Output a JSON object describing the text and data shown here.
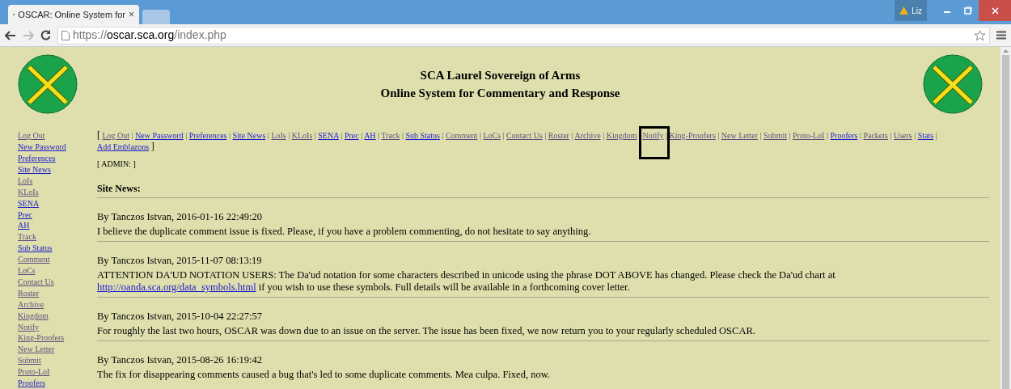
{
  "browser": {
    "tab_title": "OSCAR: Online System for",
    "tab_close": "×",
    "profile_name": "Liz",
    "url_scheme": "https://",
    "url_host": "oscar.sca.org",
    "url_path": "/index.php",
    "back_enabled": true,
    "forward_enabled": false
  },
  "header": {
    "title_line_1": "SCA Laurel Sovereign of Arms",
    "title_line_2": "Online System for Commentary and Response"
  },
  "sidebar": {
    "items": [
      {
        "label": "Log Out",
        "visited": true
      },
      {
        "label": "New Password",
        "visited": false
      },
      {
        "label": "Preferences",
        "visited": false
      },
      {
        "label": "Site News",
        "visited": false
      },
      {
        "label": "LoIs",
        "visited": true
      },
      {
        "label": "KLoIs",
        "visited": true
      },
      {
        "label": "SENA",
        "visited": false
      },
      {
        "label": "Prec",
        "visited": false
      },
      {
        "label": "AH",
        "visited": false
      },
      {
        "label": "Track",
        "visited": true
      },
      {
        "label": "Sub Status",
        "visited": false
      },
      {
        "label": "Comment",
        "visited": true
      },
      {
        "label": "LoCs",
        "visited": true
      },
      {
        "label": "Contact Us",
        "visited": true
      },
      {
        "label": "Roster",
        "visited": true
      },
      {
        "label": "Archive",
        "visited": true
      },
      {
        "label": "Kingdom",
        "visited": true
      },
      {
        "label": "Notify",
        "visited": true
      },
      {
        "label": "King-Proofers",
        "visited": true
      },
      {
        "label": "New Letter",
        "visited": true
      },
      {
        "label": "Submit",
        "visited": true
      },
      {
        "label": "Proto-LoI",
        "visited": true
      },
      {
        "label": "Proofers",
        "visited": false
      }
    ]
  },
  "nav": {
    "open_bracket": "[",
    "close_bracket": "]",
    "separator": "|",
    "links": [
      {
        "label": "Log Out",
        "visited": true,
        "highlighted": false
      },
      {
        "label": "New Password",
        "visited": false,
        "highlighted": false
      },
      {
        "label": "Preferences",
        "visited": false,
        "highlighted": false
      },
      {
        "label": "Site News",
        "visited": false,
        "highlighted": false
      },
      {
        "label": "LoIs",
        "visited": true,
        "highlighted": false
      },
      {
        "label": "KLoIs",
        "visited": true,
        "highlighted": false
      },
      {
        "label": "SENA",
        "visited": false,
        "highlighted": false
      },
      {
        "label": "Prec",
        "visited": false,
        "highlighted": false
      },
      {
        "label": "AH",
        "visited": false,
        "highlighted": false
      },
      {
        "label": "Track",
        "visited": true,
        "highlighted": false
      },
      {
        "label": "Sub Status",
        "visited": false,
        "highlighted": false
      },
      {
        "label": "Comment",
        "visited": true,
        "highlighted": false
      },
      {
        "label": "LoCs",
        "visited": true,
        "highlighted": false
      },
      {
        "label": "Contact Us",
        "visited": true,
        "highlighted": false
      },
      {
        "label": "Roster",
        "visited": true,
        "highlighted": false
      },
      {
        "label": "Archive",
        "visited": true,
        "highlighted": false
      },
      {
        "label": "Kingdom",
        "visited": true,
        "highlighted": false
      },
      {
        "label": "Notify",
        "visited": true,
        "highlighted": true
      },
      {
        "label": "King-Proofers",
        "visited": true,
        "highlighted": false
      },
      {
        "label": "New Letter",
        "visited": true,
        "highlighted": false
      },
      {
        "label": "Submit",
        "visited": true,
        "highlighted": false
      },
      {
        "label": "Proto-LoI",
        "visited": true,
        "highlighted": false
      },
      {
        "label": "Proofers",
        "visited": false,
        "highlighted": false
      },
      {
        "label": "Packets",
        "visited": true,
        "highlighted": false
      },
      {
        "label": "Users",
        "visited": true,
        "highlighted": false
      },
      {
        "label": "Stats",
        "visited": false,
        "highlighted": false
      },
      {
        "label": "Add Emblazons",
        "visited": false,
        "highlighted": false
      }
    ],
    "admin": "[ ADMIN: ]"
  },
  "news": {
    "heading": "Site News:",
    "posts": [
      {
        "byline": "By Tanczos Istvan, 2016-01-16 22:49:20",
        "body": "I believe the duplicate comment issue is fixed. Please, if you have a problem commenting, do not hesitate to say anything."
      },
      {
        "byline": "By Tanczos Istvan, 2015-11-07 08:13:19",
        "body": "ATTENTION DA'UD NOTATION USERS: The Da'ud notation for some characters described in unicode using the phrase DOT ABOVE has changed. Please check the Da'ud chart at",
        "link": "http://oanda.sca.org/data_symbols.html",
        "body_after": "if you wish to use these symbols. Full details will be available in a forthcoming cover letter."
      },
      {
        "byline": "By Tanczos Istvan, 2015-10-04 22:27:57",
        "body": "For roughly the last two hours, OSCAR was down due to an issue on the server. The issue has been fixed, we now return you to your regularly scheduled OSCAR."
      },
      {
        "byline": "By Tanczos Istvan, 2015-08-26 16:19:42",
        "body": "The fix for disappearing comments caused a bug that's led to some duplicate comments. Mea culpa. Fixed, now."
      }
    ]
  }
}
